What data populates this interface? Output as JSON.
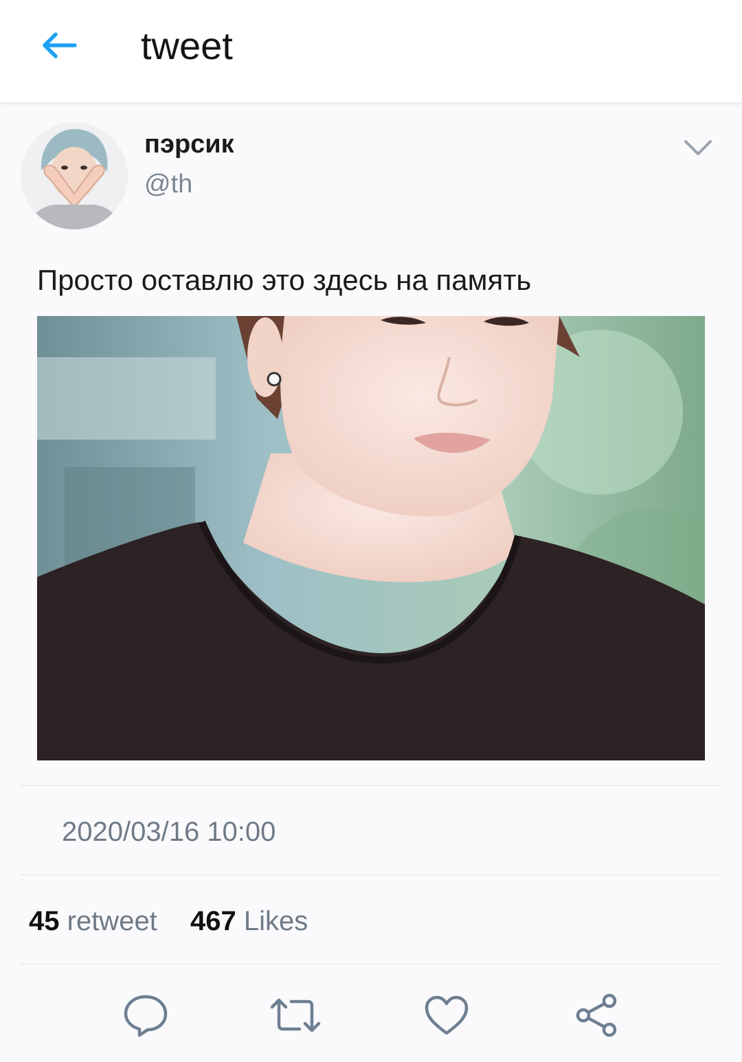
{
  "header": {
    "title": "tweet",
    "back_icon": "arrow-left-icon"
  },
  "colors": {
    "accent": "#1da1f2",
    "muted": "#7c8794",
    "action_icon": "#6e7f91"
  },
  "tweet": {
    "author": {
      "display_name": "пэрсик",
      "handle": "@th"
    },
    "text": "Просто оставлю это здесь на память",
    "timestamp": "2020/03/16 10:00",
    "stats": {
      "retweets_count": "45",
      "retweets_label": "retweet",
      "likes_count": "467",
      "likes_label": "Likes"
    }
  },
  "actions": [
    {
      "icon": "reply-icon"
    },
    {
      "icon": "retweet-icon"
    },
    {
      "icon": "like-icon"
    },
    {
      "icon": "share-icon"
    }
  ]
}
